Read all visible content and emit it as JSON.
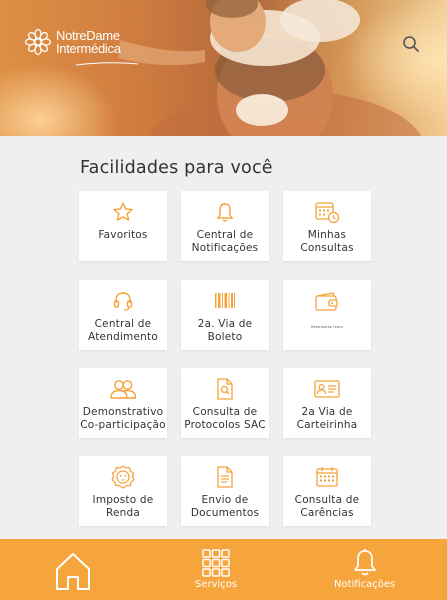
{
  "brand": {
    "line1": "NotreDame",
    "line2": "Intermédica"
  },
  "header": {
    "search_icon": "search-icon"
  },
  "section": {
    "title": "Facilidades para você"
  },
  "tiles": [
    {
      "icon": "star-icon",
      "label": "Favoritos"
    },
    {
      "icon": "bell-icon",
      "label": "Central de Notificações"
    },
    {
      "icon": "calendar-clock-icon",
      "label": "Minhas Consultas"
    },
    {
      "icon": "headset-icon",
      "label": "Central de Atendimento"
    },
    {
      "icon": "barcode-icon",
      "label": "2a. Via de Boleto"
    },
    {
      "icon": "wallet-icon",
      "label": "Reembolso Ieum"
    },
    {
      "icon": "users-icon",
      "label": "Demonstrativo Co-participação"
    },
    {
      "icon": "document-search-icon",
      "label": "Consulta de Protocolos SAC"
    },
    {
      "icon": "id-card-icon",
      "label": "2a Via de Carteirinha"
    },
    {
      "icon": "lion-icon",
      "label": "Imposto de Renda"
    },
    {
      "icon": "document-icon",
      "label": "Envio de Documentos"
    },
    {
      "icon": "calendar-grid-icon",
      "label": "Consulta de Carências"
    }
  ],
  "bottom_nav": {
    "home": {
      "icon": "home-icon",
      "label": ""
    },
    "services": {
      "icon": "grid-icon",
      "label": "Serviços"
    },
    "notifications": {
      "icon": "bell-icon",
      "label": "Notificações"
    }
  },
  "colors": {
    "accent": "#f6a53d",
    "tile_bg": "#ffffff",
    "page_bg": "#efefef",
    "text": "#333333"
  }
}
